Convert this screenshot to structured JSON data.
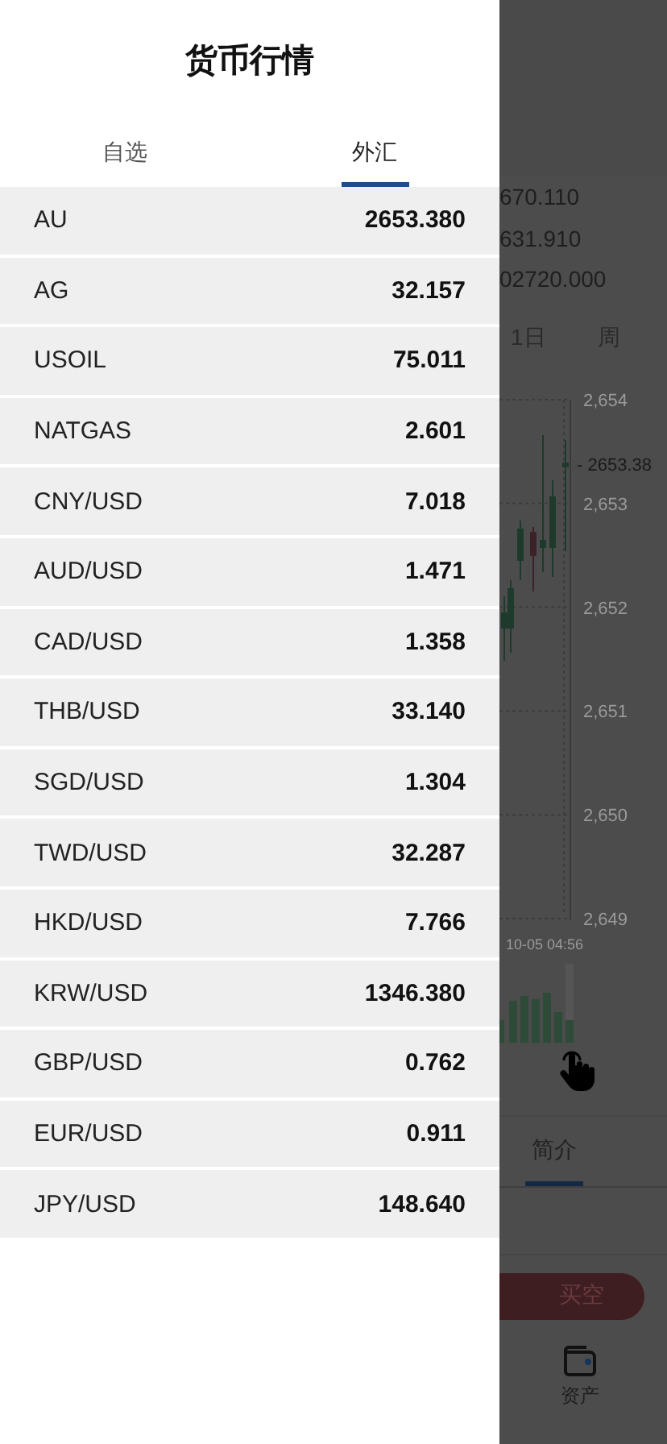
{
  "drawer": {
    "title": "货币行情",
    "tabs": [
      {
        "label": "自选",
        "selected": false
      },
      {
        "label": "外汇",
        "selected": true
      }
    ],
    "quotes": [
      {
        "symbol": "AU",
        "price": "2653.380"
      },
      {
        "symbol": "AG",
        "price": "32.157"
      },
      {
        "symbol": "USOIL",
        "price": "75.011"
      },
      {
        "symbol": "NATGAS",
        "price": "2.601"
      },
      {
        "symbol": "CNY/USD",
        "price": "7.018"
      },
      {
        "symbol": "AUD/USD",
        "price": "1.471"
      },
      {
        "symbol": "CAD/USD",
        "price": "1.358"
      },
      {
        "symbol": "THB/USD",
        "price": "33.140"
      },
      {
        "symbol": "SGD/USD",
        "price": "1.304"
      },
      {
        "symbol": "TWD/USD",
        "price": "32.287"
      },
      {
        "symbol": "HKD/USD",
        "price": "7.766"
      },
      {
        "symbol": "KRW/USD",
        "price": "1346.380"
      },
      {
        "symbol": "GBP/USD",
        "price": "0.762"
      },
      {
        "symbol": "EUR/USD",
        "price": "0.911"
      },
      {
        "symbol": "JPY/USD",
        "price": "148.640"
      }
    ]
  },
  "background": {
    "stats": [
      "670.110",
      "631.910",
      "02720.000"
    ],
    "periods": [
      "1日",
      "周"
    ],
    "price_axis": [
      "2,654",
      "2,653",
      "2,652",
      "2,651",
      "2,650",
      "2,649"
    ],
    "last_price": "- 2653.38",
    "time_label": "10-05 04:56",
    "tabs": [
      {
        "label": "简介",
        "selected": true
      }
    ],
    "sell_button": "买空",
    "nav": [
      {
        "label": "资产"
      }
    ]
  }
}
